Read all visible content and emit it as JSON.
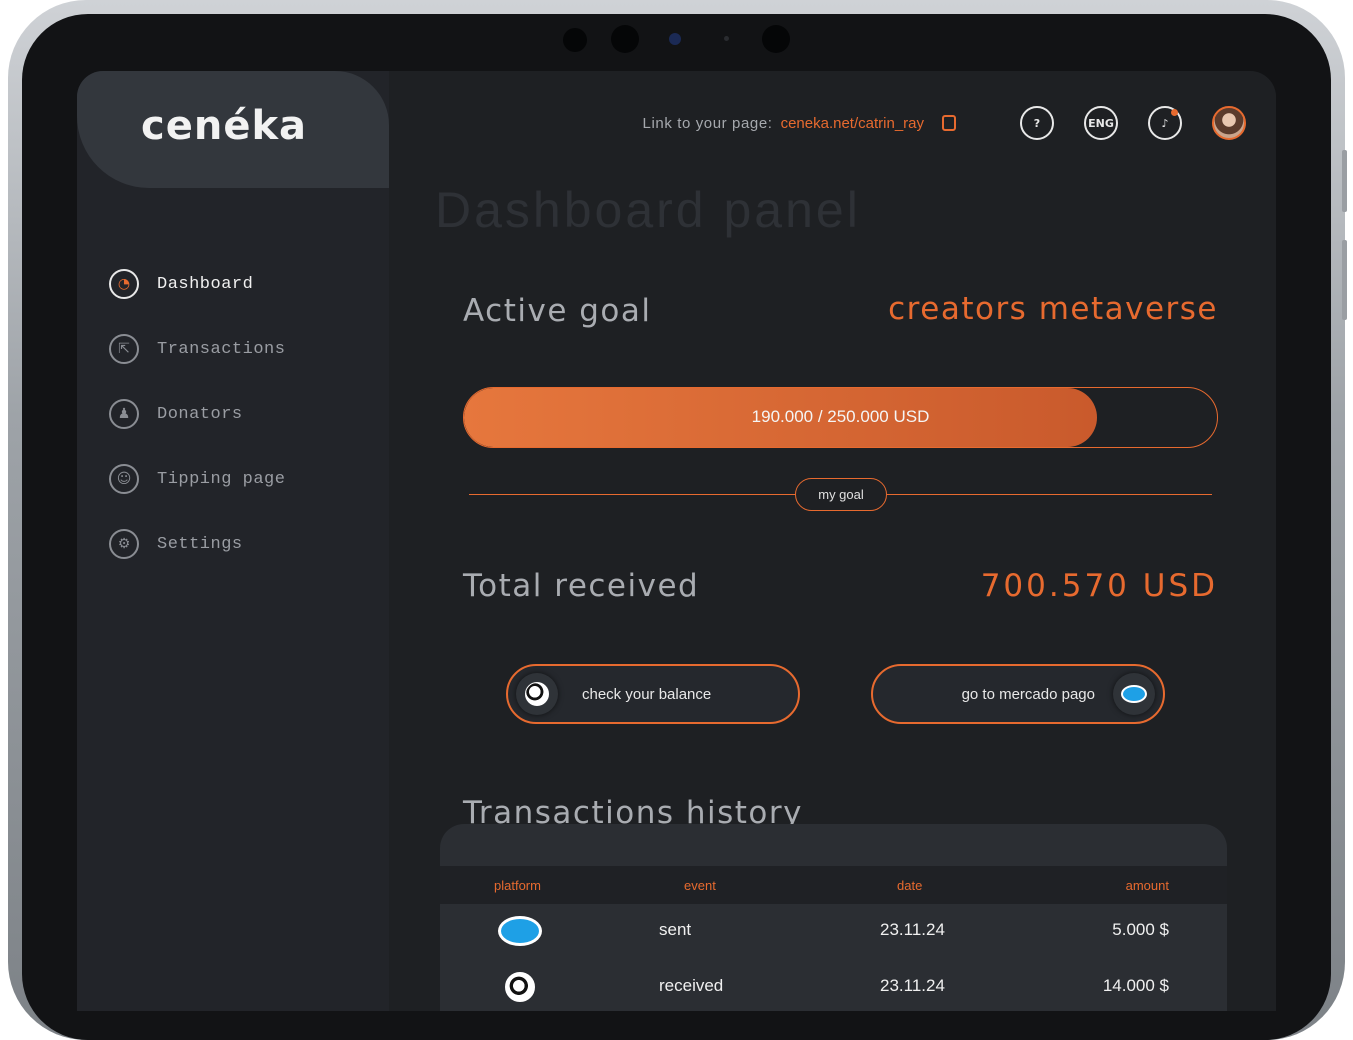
{
  "app": {
    "logo": "cenéka"
  },
  "sidebar": {
    "items": [
      {
        "label": "Dashboard",
        "icon": "dashboard-icon",
        "active": true
      },
      {
        "label": "Transactions",
        "icon": "transactions-icon",
        "active": false
      },
      {
        "label": "Donators",
        "icon": "donators-icon",
        "active": false
      },
      {
        "label": "Tipping page",
        "icon": "user-icon",
        "active": false
      },
      {
        "label": "Settings",
        "icon": "gear-icon",
        "active": false
      }
    ]
  },
  "header": {
    "link_label": "Link to your page:",
    "link_url": "ceneka.net/catrin_ray",
    "help_icon": "help-icon",
    "language": "ENG",
    "notification_icon": "bell-icon"
  },
  "main": {
    "title": "Dashboard panel",
    "active_goal": {
      "label": "Active goal",
      "name": "creators metaverse",
      "progress_text": "190.000 / 250.000 USD",
      "progress_fraction": 0.84,
      "my_goal_label": "my goal"
    },
    "total_received": {
      "label": "Total received",
      "value": "700.570 USD"
    },
    "actions": {
      "check_balance": "check your balance",
      "mercado_pago": "go to mercado pago"
    },
    "transactions": {
      "title": "Transactions history",
      "columns": [
        "platform",
        "event",
        "date",
        "amount"
      ],
      "rows": [
        {
          "platform": "mercado-pago-icon",
          "event": "sent",
          "date": "23.11.24",
          "amount": "5.000 $"
        },
        {
          "platform": "globe-icon",
          "event": "received",
          "date": "23.11.24",
          "amount": "14.000 $"
        }
      ]
    }
  },
  "colors": {
    "accent": "#e76a2f",
    "background": "#1e2023",
    "sidebar": "#222429"
  }
}
